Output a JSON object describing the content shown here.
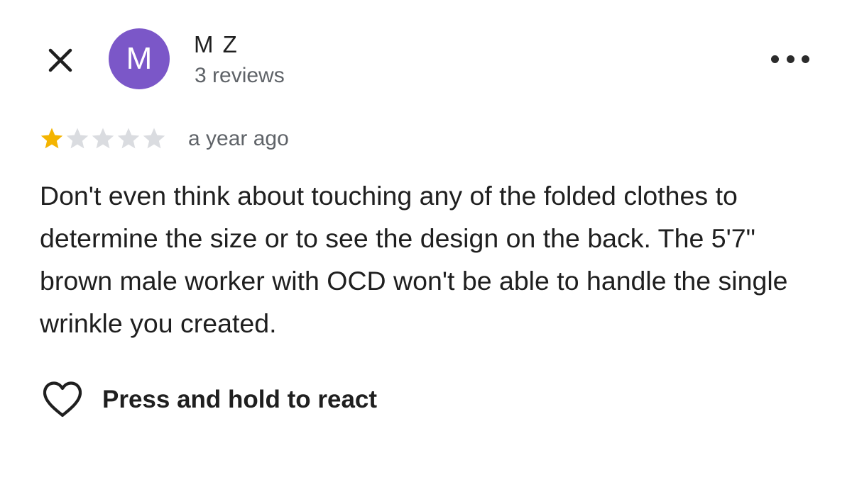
{
  "header": {
    "avatar_letter": "M",
    "avatar_color": "#7b57c8",
    "user_name": "M Z",
    "review_count": "3 reviews",
    "close_icon": "close-icon",
    "more_icon": "more-horizontal-icon"
  },
  "review": {
    "rating": 1,
    "max_rating": 5,
    "star_filled_color": "#f4b400",
    "star_empty_color": "#dadce0",
    "time_ago": "a year ago",
    "text": "Don't even think about touching any of the folded clothes to determine the size or to see the design on the back. The 5'7\" brown male worker with OCD won't be able to handle the single wrinkle you created."
  },
  "reaction": {
    "icon": "heart-outline-icon",
    "label": "Press and hold to react"
  }
}
